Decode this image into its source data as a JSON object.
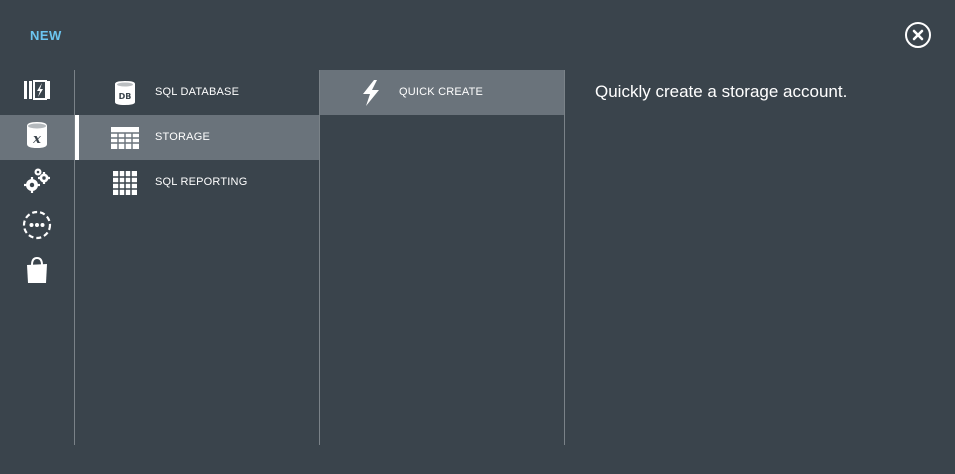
{
  "header": {
    "title": "NEW",
    "title_color": "#6cc5f0",
    "close_icon": "close-icon"
  },
  "rail": {
    "items": [
      {
        "icon": "compute-services-icon",
        "selected": false
      },
      {
        "icon": "data-services-icon",
        "selected": true
      },
      {
        "icon": "app-services-icon",
        "selected": false
      },
      {
        "icon": "network-services-icon",
        "selected": false
      },
      {
        "icon": "store-bag-icon",
        "selected": false
      }
    ]
  },
  "categories": {
    "items": [
      {
        "label": "SQL DATABASE",
        "icon": "sql-database-icon",
        "selected": false
      },
      {
        "label": "STORAGE",
        "icon": "storage-table-icon",
        "selected": true
      },
      {
        "label": "SQL REPORTING",
        "icon": "sql-reporting-grid-icon",
        "selected": false
      }
    ]
  },
  "actions": {
    "items": [
      {
        "label": "QUICK CREATE",
        "icon": "lightning-bolt-icon",
        "selected": true
      }
    ]
  },
  "details": {
    "description": "Quickly create a storage account."
  },
  "colors": {
    "background": "#3a444c",
    "selected": "#6a737b",
    "divider": "#7a8288"
  }
}
